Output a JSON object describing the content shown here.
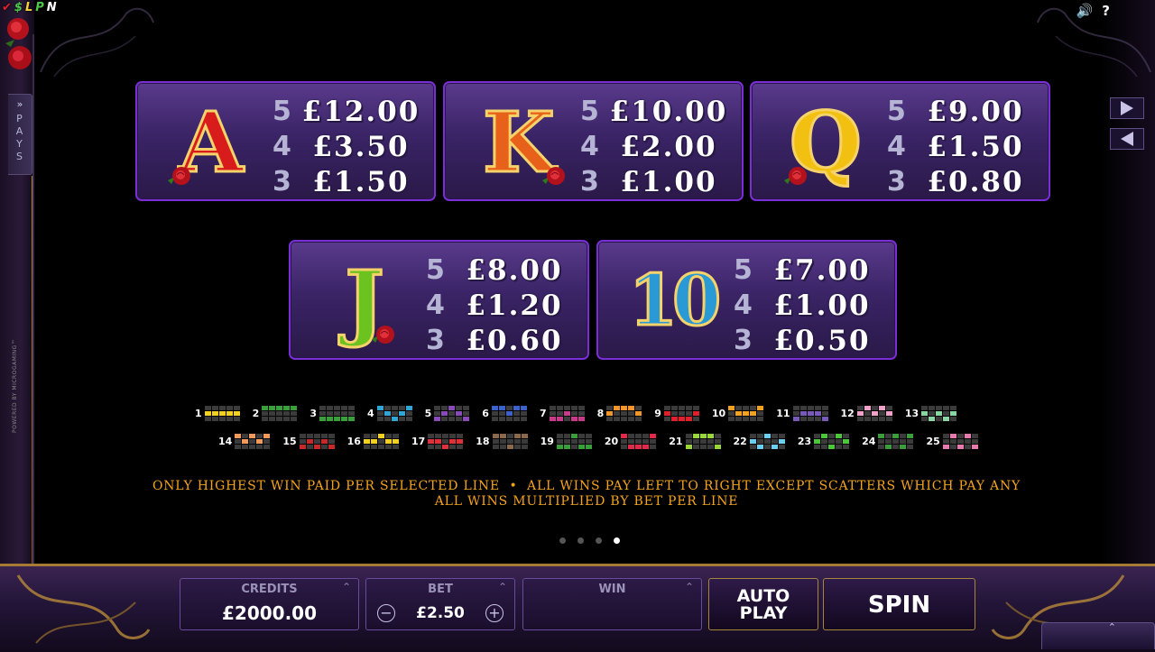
{
  "status_letters": [
    {
      "label": "✔",
      "color": "#e0202a"
    },
    {
      "label": "$",
      "color": "#4cc84a"
    },
    {
      "label": "L",
      "color": "#f3d23a"
    },
    {
      "label": "P",
      "color": "#4cc84a"
    },
    {
      "label": "N",
      "color": "#ffffff"
    }
  ],
  "top_icons": {
    "sound": "🔊",
    "help": "?"
  },
  "pays_tab": {
    "chevron": "»",
    "label": "PAYS"
  },
  "powered_by": "POWERED BY MICROGAMING™",
  "cards": [
    {
      "symbol": "A",
      "color": "#d81c1c",
      "pays": [
        {
          "count": "5",
          "amount": "£12.00"
        },
        {
          "count": "4",
          "amount": "£3.50"
        },
        {
          "count": "3",
          "amount": "£1.50"
        }
      ]
    },
    {
      "symbol": "K",
      "color": "#e8611a",
      "pays": [
        {
          "count": "5",
          "amount": "£10.00"
        },
        {
          "count": "4",
          "amount": "£2.00"
        },
        {
          "count": "3",
          "amount": "£1.00"
        }
      ]
    },
    {
      "symbol": "Q",
      "color": "#f2c011",
      "pays": [
        {
          "count": "5",
          "amount": "£9.00"
        },
        {
          "count": "4",
          "amount": "£1.50"
        },
        {
          "count": "3",
          "amount": "£0.80"
        }
      ]
    },
    {
      "symbol": "J",
      "color": "#6cc21e",
      "pays": [
        {
          "count": "5",
          "amount": "£8.00"
        },
        {
          "count": "4",
          "amount": "£1.20"
        },
        {
          "count": "3",
          "amount": "£0.60"
        }
      ]
    },
    {
      "symbol": "10",
      "color": "#2a9ad6",
      "pays": [
        {
          "count": "5",
          "amount": "£7.00"
        },
        {
          "count": "4",
          "amount": "£1.00"
        },
        {
          "count": "3",
          "amount": "£0.50"
        }
      ]
    }
  ],
  "paylines": [
    {
      "num": "1",
      "color": "#f2d21e",
      "cells": [
        5,
        6,
        7,
        8,
        9
      ]
    },
    {
      "num": "2",
      "color": "#3a9e3a",
      "cells": [
        0,
        1,
        2,
        3,
        4
      ]
    },
    {
      "num": "3",
      "color": "#3a9e3a",
      "cells": [
        10,
        11,
        12,
        13,
        14
      ]
    },
    {
      "num": "4",
      "color": "#2fa6d6",
      "cells": [
        0,
        6,
        12,
        8,
        4
      ]
    },
    {
      "num": "5",
      "color": "#8a4ab8",
      "cells": [
        10,
        6,
        2,
        8,
        14
      ]
    },
    {
      "num": "6",
      "color": "#3a62c8",
      "cells": [
        0,
        1,
        7,
        3,
        4
      ]
    },
    {
      "num": "7",
      "color": "#c83a8a",
      "cells": [
        10,
        11,
        7,
        13,
        14
      ]
    },
    {
      "num": "8",
      "color": "#f2962a",
      "cells": [
        5,
        1,
        2,
        3,
        9
      ]
    },
    {
      "num": "9",
      "color": "#e0202a",
      "cells": [
        5,
        11,
        12,
        13,
        9
      ]
    },
    {
      "num": "10",
      "color": "#f2a21e",
      "cells": [
        0,
        6,
        7,
        8,
        4
      ]
    },
    {
      "num": "11",
      "color": "#7a5ab8",
      "cells": [
        10,
        6,
        7,
        8,
        14
      ]
    },
    {
      "num": "12",
      "color": "#f2a2c8",
      "cells": [
        5,
        1,
        7,
        3,
        9
      ]
    },
    {
      "num": "13",
      "color": "#8ad6a2",
      "cells": [
        5,
        11,
        7,
        13,
        9
      ]
    },
    {
      "num": "14",
      "color": "#f29a5a",
      "cells": [
        0,
        6,
        2,
        8,
        4
      ]
    },
    {
      "num": "15",
      "color": "#c8282a",
      "cells": [
        10,
        6,
        12,
        8,
        14
      ]
    },
    {
      "num": "16",
      "color": "#f2d21e",
      "cells": [
        5,
        6,
        2,
        8,
        9
      ]
    },
    {
      "num": "17",
      "color": "#e0303a",
      "cells": [
        5,
        6,
        12,
        8,
        9
      ]
    },
    {
      "num": "18",
      "color": "#8a6a4a",
      "cells": [
        0,
        1,
        12,
        3,
        4
      ]
    },
    {
      "num": "19",
      "color": "#3a9e3a",
      "cells": [
        10,
        11,
        2,
        13,
        14
      ]
    },
    {
      "num": "20",
      "color": "#e02a4a",
      "cells": [
        0,
        11,
        12,
        13,
        4
      ]
    },
    {
      "num": "21",
      "color": "#9ad63a",
      "cells": [
        10,
        1,
        2,
        3,
        14
      ]
    },
    {
      "num": "22",
      "color": "#6ad0f2",
      "cells": [
        5,
        11,
        2,
        13,
        9
      ]
    },
    {
      "num": "23",
      "color": "#4ac83a",
      "cells": [
        5,
        1,
        12,
        3,
        9
      ]
    },
    {
      "num": "24",
      "color": "#3a9e3a",
      "cells": [
        0,
        11,
        2,
        13,
        4
      ]
    },
    {
      "num": "25",
      "color": "#e87ab0",
      "cells": [
        10,
        1,
        12,
        3,
        14
      ]
    }
  ],
  "rules": {
    "line1": "ONLY HIGHEST WIN PAID PER SELECTED LINE  •  ALL WINS PAY LEFT TO RIGHT EXCEPT SCATTERS WHICH PAY ANY",
    "line2": "ALL WINS MULTIPLIED BY BET PER LINE"
  },
  "page_dots": {
    "total": 4,
    "active": 3
  },
  "controls": {
    "credits": {
      "label": "CREDITS",
      "value": "£2000.00"
    },
    "bet": {
      "label": "BET",
      "value": "£2.50",
      "minus": "−",
      "plus": "+"
    },
    "win": {
      "label": "WIN",
      "value": ""
    },
    "autoplay": {
      "line1": "AUTO",
      "line2": "PLAY"
    },
    "spin": "SPIN",
    "up_chevron": "⌃"
  }
}
